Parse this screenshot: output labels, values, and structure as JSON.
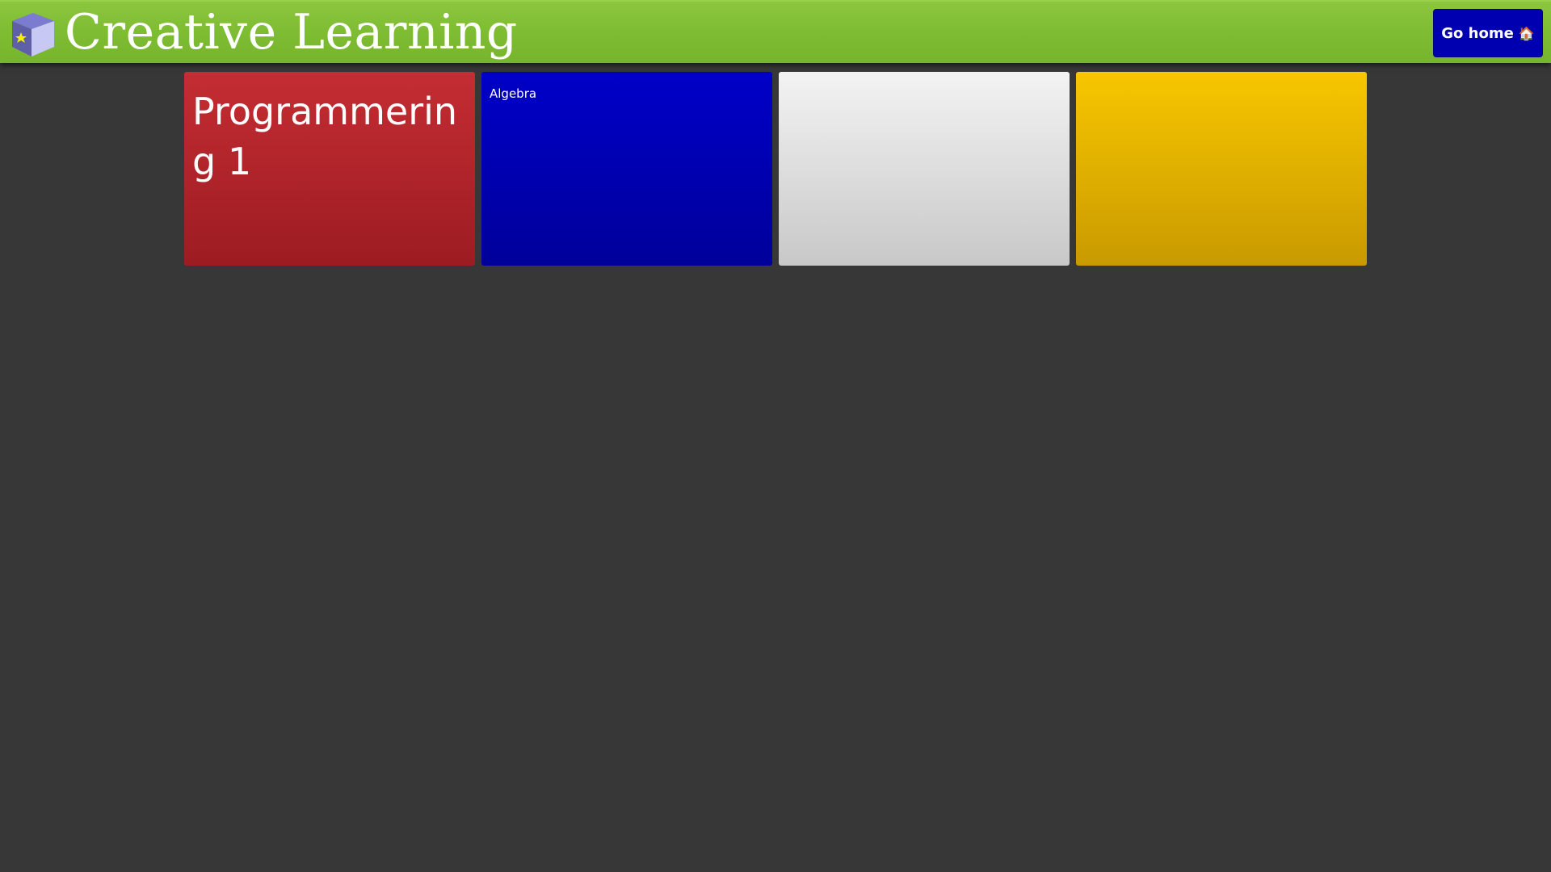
{
  "header": {
    "title": "Creative Learning",
    "logo_icon": "cube-star-icon",
    "home_button_label": "Go home",
    "home_button_icon": "🏠",
    "accent_color": "#7fbd33"
  },
  "tiles": [
    {
      "label": "Programmering 1",
      "color": "#b5262c"
    },
    {
      "label": "Algebra",
      "color": "#0000b4"
    },
    {
      "label": "",
      "color": "#dedede"
    },
    {
      "label": "",
      "color": "#e2b200"
    }
  ]
}
